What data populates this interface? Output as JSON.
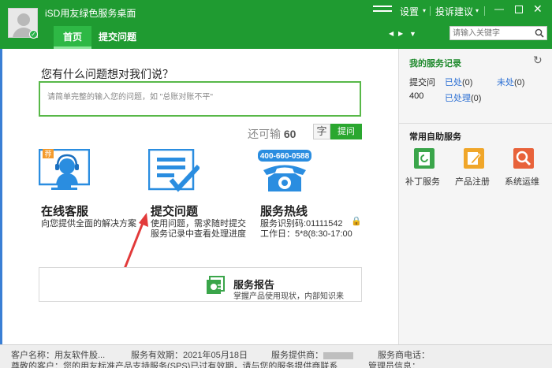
{
  "header": {
    "app_title": "iSD用友绿色服务桌面",
    "tabs": [
      {
        "label": "首页"
      },
      {
        "label": "提交问题"
      }
    ],
    "settings_label": "设置",
    "complaint_label": "投诉建议",
    "search_placeholder": "请输入关键字"
  },
  "question": {
    "title": "您有什么问题想对我们说？",
    "placeholder": "请简单完整的输入您的问题，如 \"总账对账不平\"",
    "remain_prefix": "还可输",
    "remain_count": "60",
    "remain_unit": "字",
    "submit_label": "提问"
  },
  "tiles": {
    "online": {
      "badge": "荐",
      "title": "在线客服",
      "desc": "向您提供全面的解决方案"
    },
    "submit": {
      "title": "提交问题",
      "desc_line1": "使用问题，需求随时提交",
      "desc_line2": "服务记录中查看处理进度"
    },
    "hotline": {
      "phone_badge": "400-660-0588",
      "title": "服务热线",
      "desc_line1": "服务识别码:01111542",
      "desc_line2": "工作日：5*8(8:30-17:00"
    }
  },
  "report": {
    "title": "服务报告",
    "desc": "掌握产品使用现状，内部知识来"
  },
  "sidebar": {
    "records_title": "我的服务记录",
    "submitted_label": "提交问",
    "processed_label": "已处",
    "processed_count": "(0)",
    "unprocessed_label": "未处",
    "unprocessed_count": "(0)",
    "count_400": "400",
    "handled_label": "已处理",
    "handled_count": "(0)",
    "self_service_title": "常用自助服务",
    "services": [
      {
        "label": "补丁服务",
        "icon": "patch-icon",
        "color": "#3aa54a"
      },
      {
        "label": "产品注册",
        "icon": "register-icon",
        "color": "#f0a629"
      },
      {
        "label": "系统运维",
        "icon": "maintenance-icon",
        "color": "#e8623a"
      }
    ]
  },
  "status": {
    "customer_name_label": "客户名称：用友软件股...",
    "valid_label": "服务有效期：2021年05月18日",
    "provider_label": "服务提供商：",
    "provider_phone_label": "服务商电话：",
    "notice_text": "尊敬的客户：您的用友标准产品支持服务(SPS)已过有效期，请与您的服务提供商联系",
    "admin_label": "管理员信息："
  }
}
